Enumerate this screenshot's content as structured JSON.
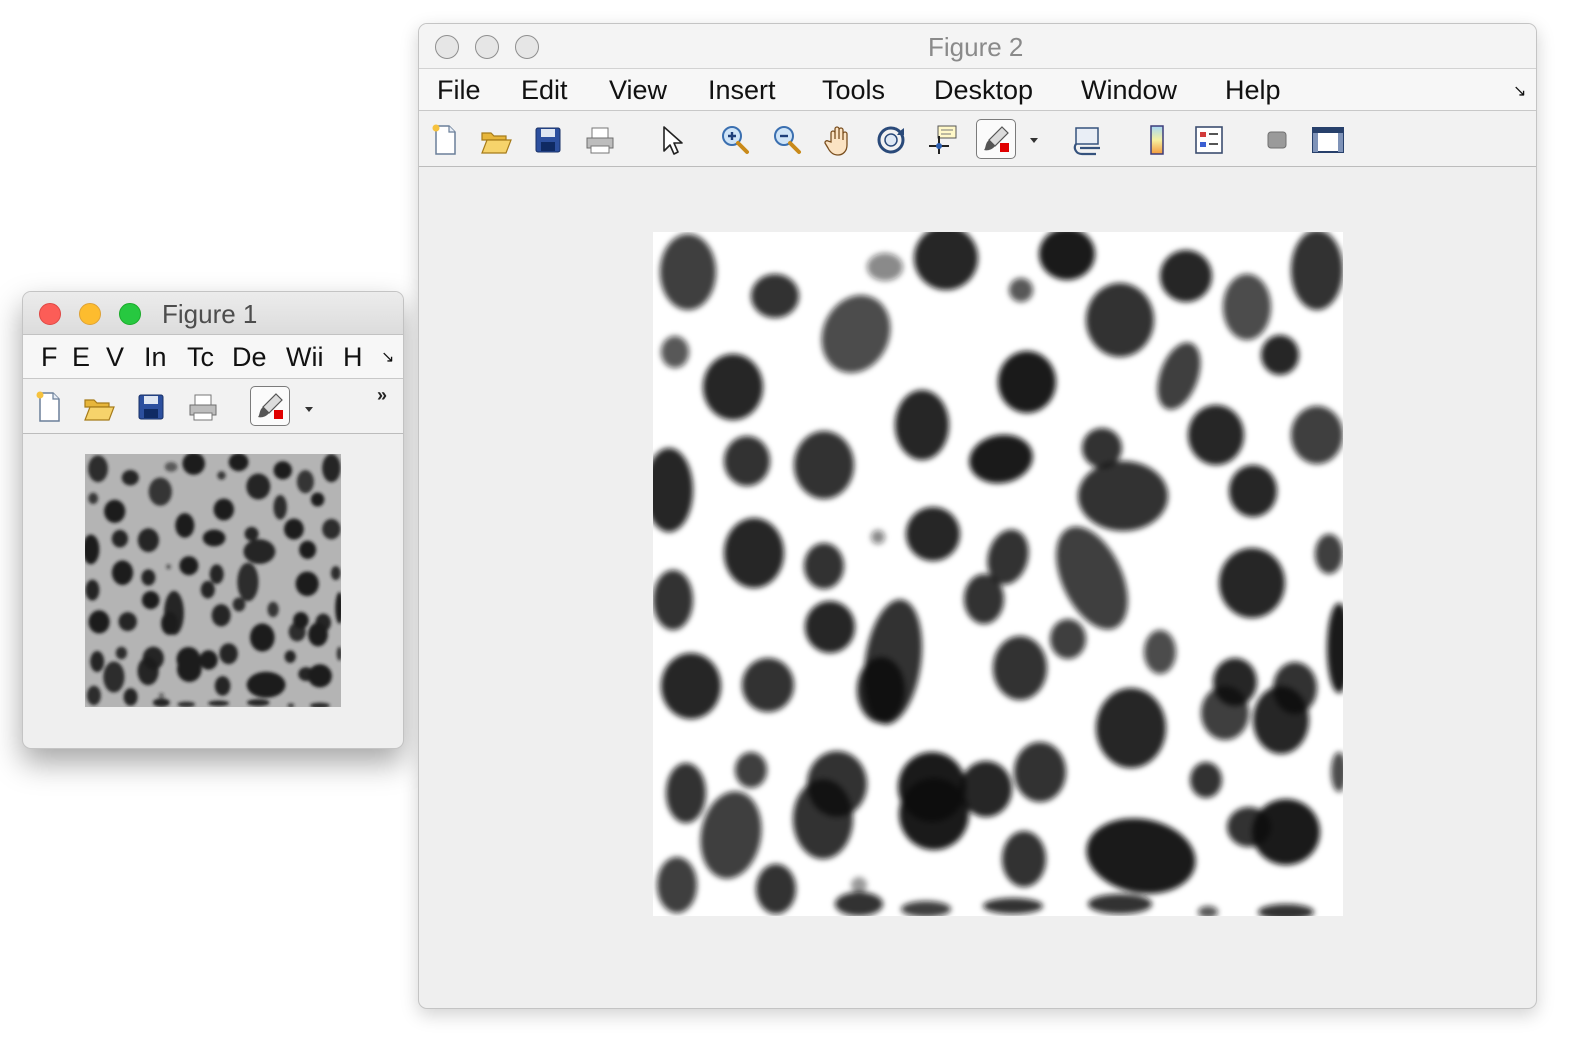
{
  "figure1": {
    "title": "Figure 1",
    "menus": [
      "F",
      "E",
      "V",
      "In",
      "Tc",
      "De",
      "Wii",
      "H"
    ],
    "toolbar_overflow_glyph": "»",
    "image_icon": "blob-image"
  },
  "figure2": {
    "title": "Figure 2",
    "menus": [
      "File",
      "Edit",
      "View",
      "Insert",
      "Tools",
      "Desktop",
      "Window",
      "Help"
    ],
    "image_icon": "blob-image-thresholded"
  },
  "icons": {
    "new": "new-figure-icon",
    "open": "open-file-icon",
    "save": "save-icon",
    "print": "print-icon",
    "pointer": "edit-plot-arrow-icon",
    "zoom_in": "zoom-in-icon",
    "zoom_out": "zoom-out-icon",
    "pan": "pan-hand-icon",
    "rotate": "rotate-3d-icon",
    "data_cursor": "data-cursor-icon",
    "brush": "brush-icon",
    "link": "link-plot-icon",
    "colorbar": "colorbar-icon",
    "legend": "legend-icon",
    "hide_tools": "hide-plot-tools-icon",
    "show_tools": "show-plot-tools-icon"
  },
  "colors": {
    "close": "#fc5d57",
    "minimize": "#fdbc2e",
    "zoom": "#27c840",
    "brush_accent": "#e00000"
  }
}
